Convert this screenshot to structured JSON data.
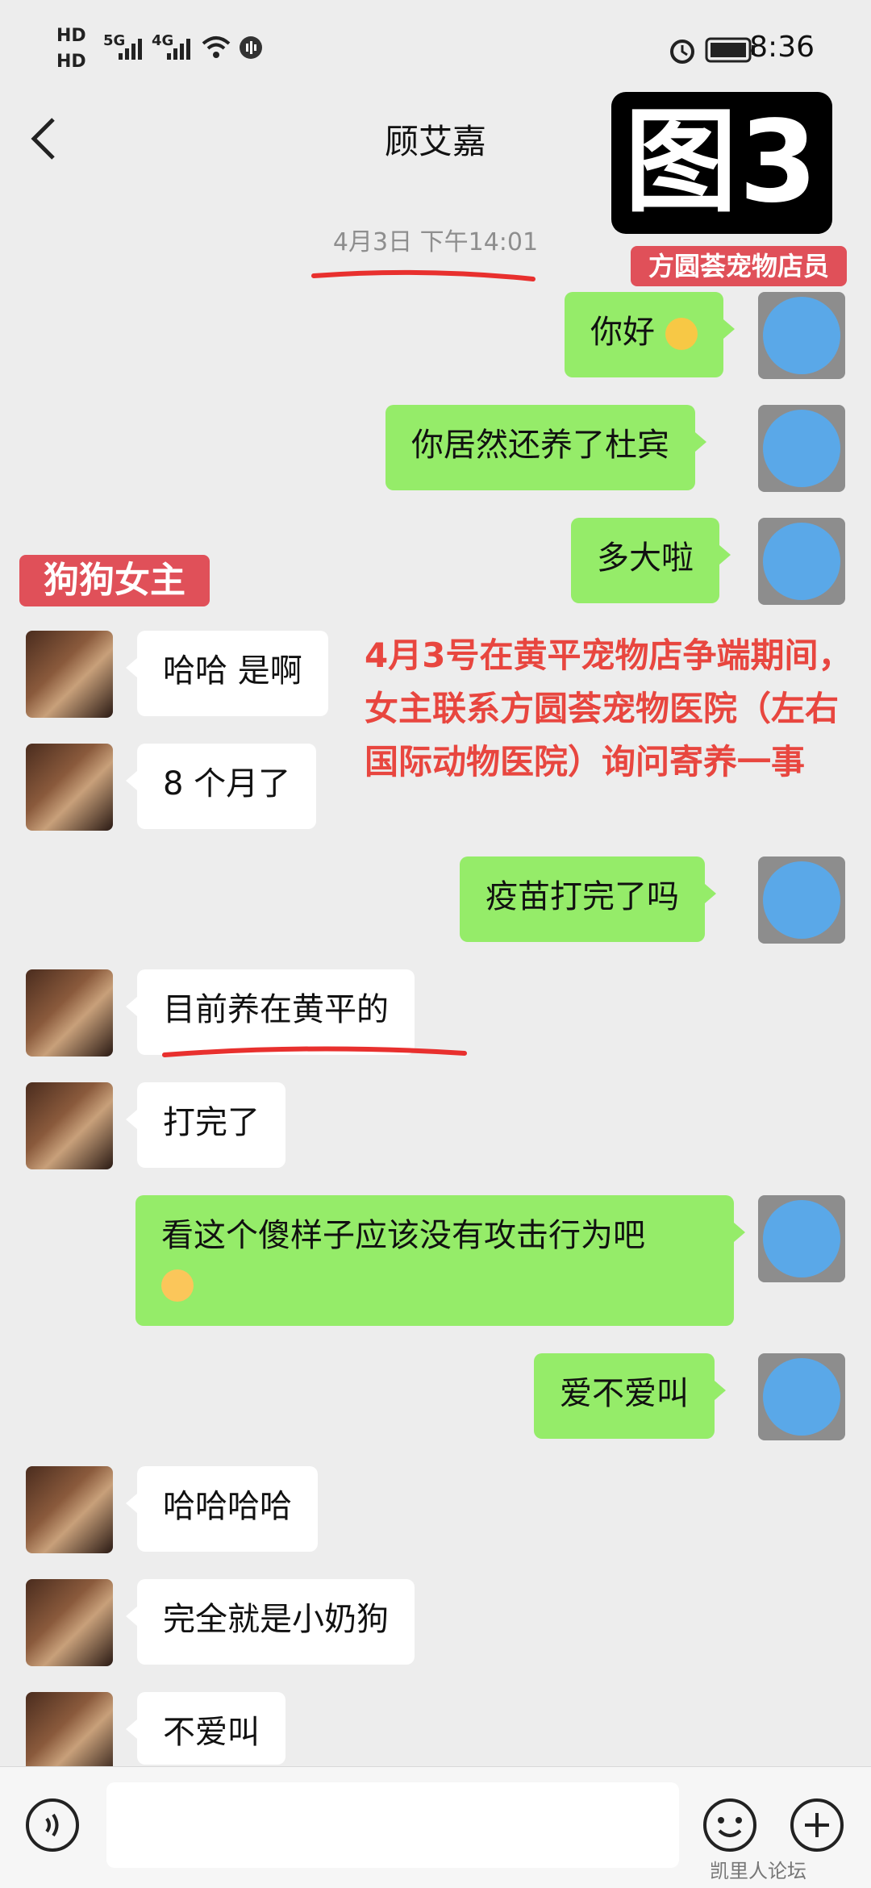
{
  "status_bar": {
    "hd1": "HD",
    "hd2": "HD",
    "net1": "5G",
    "net2": "4G",
    "time": "8:36"
  },
  "nav": {
    "title": "顾艾嘉"
  },
  "overlay": {
    "figure_tag": "图3",
    "label_shop": "方圆荟宠物店员",
    "label_girl": "狗狗女主",
    "annotation": "4月3号在黄平宠物店争端期间，女主联系方圆荟宠物医院（左右国际动物医院）询问寄养一事"
  },
  "timestamp": "4月3日 下午14:01",
  "messages": [
    {
      "side": "right",
      "text": "你好"
    },
    {
      "side": "right",
      "text": "你居然还养了杜宾"
    },
    {
      "side": "right",
      "text": "多大啦"
    },
    {
      "side": "left",
      "text": "哈哈 是啊"
    },
    {
      "side": "left",
      "text": "8 个月了"
    },
    {
      "side": "right",
      "text": "疫苗打完了吗"
    },
    {
      "side": "left",
      "text": "目前养在黄平的"
    },
    {
      "side": "left",
      "text": "打完了"
    },
    {
      "side": "right",
      "text": "看这个傻样子应该没有攻击行为吧"
    },
    {
      "side": "right",
      "text": "爱不爱叫"
    },
    {
      "side": "left",
      "text": "哈哈哈哈"
    },
    {
      "side": "left",
      "text": "完全就是小奶狗"
    },
    {
      "side": "left",
      "text": "不爱叫"
    }
  ],
  "watermark": "凯里人论坛",
  "icons": {
    "back": "back-arrow-icon",
    "more": "more-icon",
    "voice": "voice-icon",
    "emoji": "emoji-icon",
    "add": "add-icon"
  }
}
